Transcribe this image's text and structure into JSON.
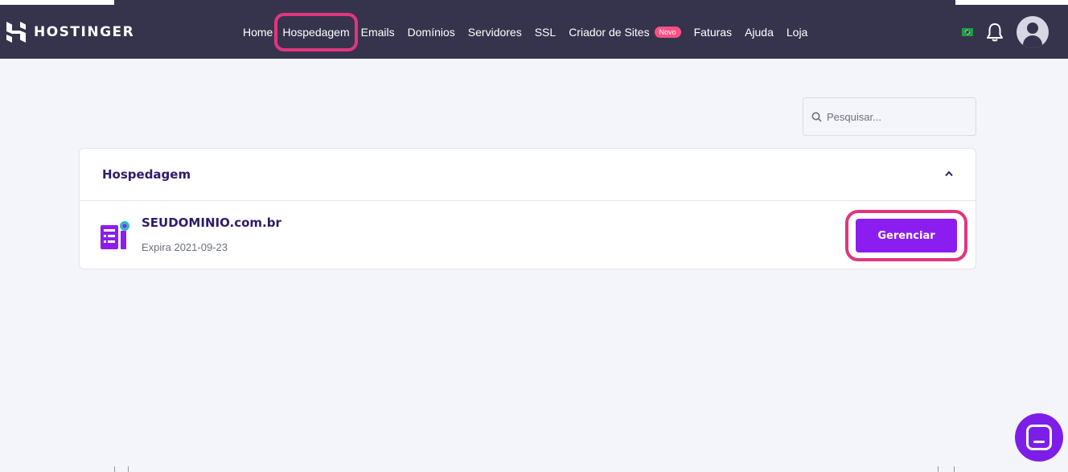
{
  "brand": {
    "name": "HOSTINGER"
  },
  "nav": {
    "items": [
      {
        "label": "Home"
      },
      {
        "label": "Hospedagem",
        "highlighted": true
      },
      {
        "label": "Emails"
      },
      {
        "label": "Domínios"
      },
      {
        "label": "Servidores"
      },
      {
        "label": "SSL"
      },
      {
        "label": "Criador de Sites",
        "badge": "Novo"
      },
      {
        "label": "Faturas"
      },
      {
        "label": "Ajuda"
      },
      {
        "label": "Loja"
      }
    ],
    "icons": [
      "brazil-flag-icon",
      "bell-icon",
      "user-avatar-icon"
    ]
  },
  "search": {
    "placeholder": "Pesquisar..."
  },
  "hosting_card": {
    "title": "Hospedagem",
    "items": [
      {
        "domain": "SEUDOMINIO.com.br",
        "expiry": "Expira 2021-09-23",
        "action_label": "Gerenciar",
        "highlighted": true
      }
    ]
  },
  "colors": {
    "nav_bg": "#36344d",
    "accent_purple": "#8c1df0",
    "highlight_pink": "#e1367f",
    "badge_pink": "#fc5185",
    "page_bg": "#f4f4fb"
  }
}
